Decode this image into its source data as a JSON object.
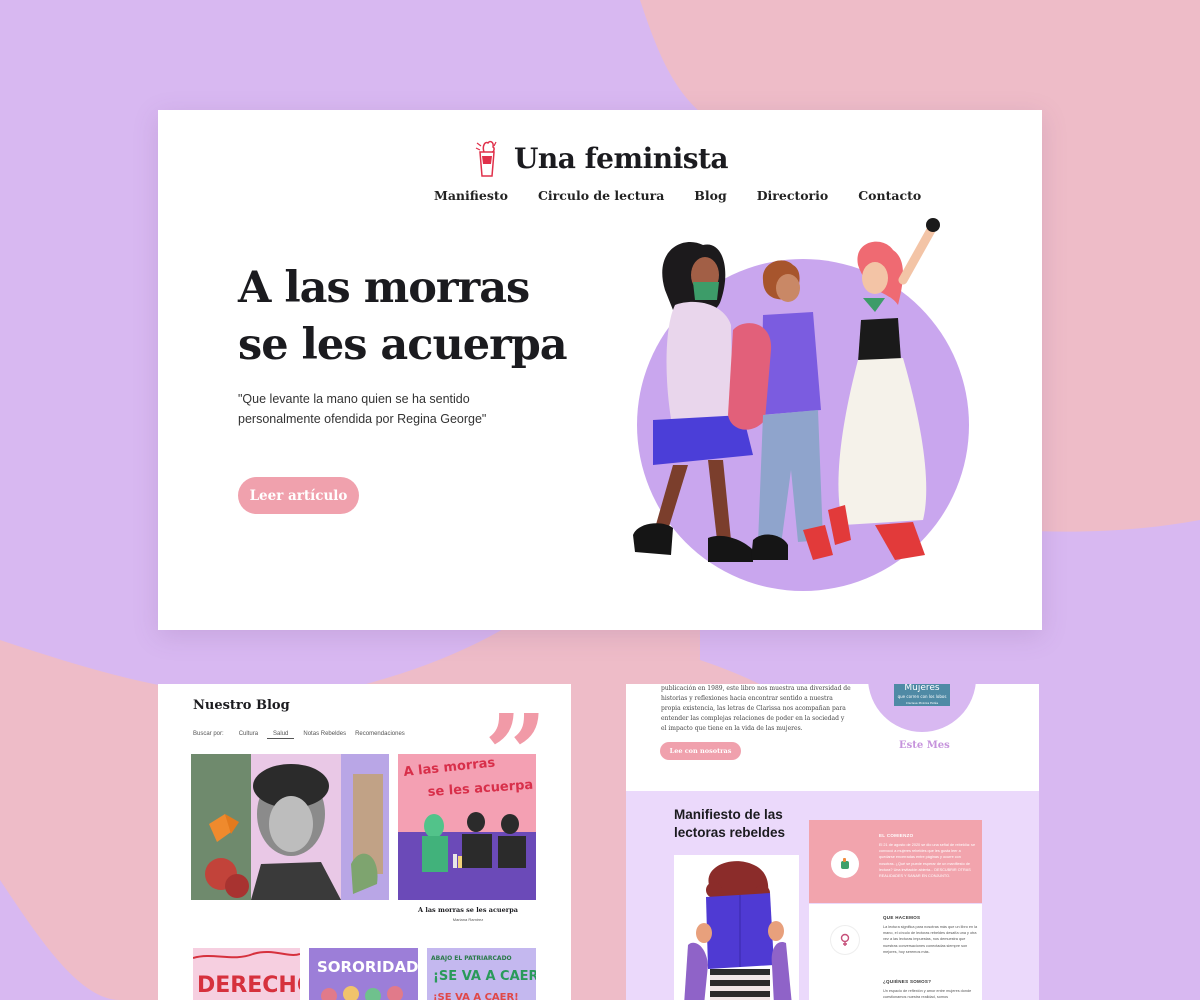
{
  "brand": {
    "name": "Una feminista",
    "logo_icon": "raised-fist-glass-icon"
  },
  "nav": {
    "items": [
      "Manifiesto",
      "Circulo de lectura",
      "Blog",
      "Directorio",
      "Contacto"
    ]
  },
  "hero": {
    "title": "A las morras se les acuerpa",
    "quote": "\"Que levante la mano quien se ha sentido personalmente ofendida por Regina George\"",
    "button": "Leer artículo"
  },
  "blog": {
    "title": "Nuestro Blog",
    "filters": [
      "Buscar por:",
      "Cultura",
      "Salud",
      "Notas Rebeldes",
      "Recomendaciones"
    ],
    "active_filter": "Salud",
    "featured_caption": "A las morras se les acuerpa",
    "featured_author": "Mariana Ramirez",
    "poster_texts": [
      "A las morras se les acuerpa",
      "DERECHO",
      "SORORIDAD",
      "ABAJO EL PATRIARCADO",
      "¡SE VA A CAER!",
      "¡SE VA A CAER!"
    ]
  },
  "reading_circle": {
    "text": "publicación en 1989, este libro nos muestra una diversidad de historias y reflexiones hacia encontrar sentido a nuestra propia existencia, las letras de Clarissa nos acompañan para entender las complejas relaciones de poder en la sociedad y el impacto que tiene en la vida de las mujeres.",
    "button": "Lee con nosotras",
    "book_title": "Mujeres",
    "book_subtitle": "que corren con los lobos",
    "book_author": "Clarissa Pinkola Estés",
    "month_label": "Este Mes"
  },
  "manifesto": {
    "title": "Manifiesto de las lectoras rebeldes",
    "block1_label": "EL COMIENZO",
    "block1_text": "El 21 de agosto de 2020 se dio una señal de rebeldía: se convocó a mujeres rebeldes que les gusta leer a quedarse encerradas entre páginas y ocurre con nosotras. ¿Qué se puede esperar de un manifiesto de lectura? Una invitación abierta... DESCUBRIR OTRAS REALIDADES Y SANAR EN CONJUNTO.",
    "block2_label": "QUE HACEMOS",
    "block2_text": "La lectura significa para nosotras más que un libro en la mano, el círculo de lectoras rebeldes desafía una y otra vez a las lecturas impuestas, nos demuestra que nuestras conversaciones conectadas siempre son mejores, hoy seremos más.",
    "block3_label": "¿QUIÉNES SOMOS?",
    "block3_text": "Un espacio de reflexión y amor entre mujeres donde cuestionamos nuestra realidad, somos"
  },
  "colors": {
    "lavender": "#d8b8f1",
    "pink_bg": "#eebcc8",
    "accent_pink": "#f0a1ad",
    "purple_circle": "#c9a6ee",
    "lavender_band": "#ebd9fb",
    "dark_text": "#1b1b1f"
  }
}
